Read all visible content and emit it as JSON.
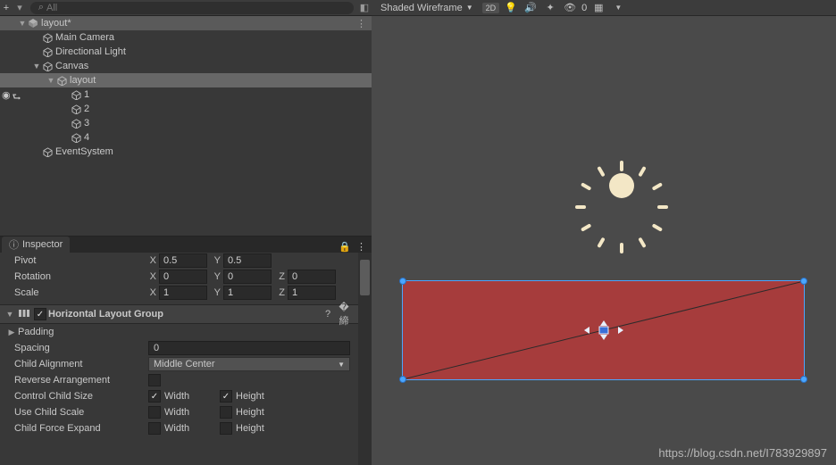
{
  "hierarchy": {
    "search_placeholder": "All",
    "scene_name": "layout*",
    "items": [
      {
        "label": "Main Camera",
        "indent": 2
      },
      {
        "label": "Directional Light",
        "indent": 2
      },
      {
        "label": "Canvas",
        "indent": 2,
        "expandable": true
      },
      {
        "label": "layout",
        "indent": 3,
        "expandable": true,
        "selected": true
      },
      {
        "label": "1",
        "indent": 4
      },
      {
        "label": "2",
        "indent": 4
      },
      {
        "label": "3",
        "indent": 4
      },
      {
        "label": "4",
        "indent": 4
      },
      {
        "label": "EventSystem",
        "indent": 2
      }
    ]
  },
  "inspector": {
    "tab_label": "Inspector",
    "pivot": {
      "label": "Pivot",
      "x": "0.5",
      "y": "0.5"
    },
    "rotation": {
      "label": "Rotation",
      "x": "0",
      "y": "0",
      "z": "0"
    },
    "scale": {
      "label": "Scale",
      "x": "1",
      "y": "1",
      "z": "1"
    },
    "axis": {
      "x": "X",
      "y": "Y",
      "z": "Z"
    },
    "component": {
      "title": "Horizontal Layout Group",
      "padding": "Padding",
      "spacing": {
        "label": "Spacing",
        "value": "0"
      },
      "child_alignment": {
        "label": "Child Alignment",
        "value": "Middle Center"
      },
      "reverse": {
        "label": "Reverse Arrangement",
        "value": false
      },
      "control_child_size": {
        "label": "Control Child Size",
        "width": true,
        "height": true
      },
      "use_child_scale": {
        "label": "Use Child Scale",
        "width": false,
        "height": false
      },
      "child_force_expand": {
        "label": "Child Force Expand",
        "width": false,
        "height": false
      },
      "width_label": "Width",
      "height_label": "Height"
    }
  },
  "scene": {
    "shading_mode": "Shaded Wireframe",
    "btn2d": "2D",
    "hidden_count": "0"
  },
  "watermark": "https://blog.csdn.net/I783929897"
}
